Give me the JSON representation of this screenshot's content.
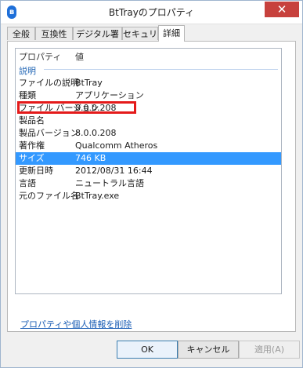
{
  "window": {
    "title": "BtTrayのプロパティ",
    "close_glyph": "✕",
    "app_icon_glyph": "ʙ"
  },
  "tabs": [
    {
      "label": "全般",
      "active": false
    },
    {
      "label": "互換性",
      "active": false
    },
    {
      "label": "デジタル署名",
      "active": false
    },
    {
      "label": "セキュリティ",
      "active": false
    },
    {
      "label": "詳細",
      "active": true
    }
  ],
  "details": {
    "header": {
      "property": "プロパティ",
      "value": "値"
    },
    "group": "説明",
    "rows": [
      {
        "key": "ファイルの説明",
        "value": "BtTray"
      },
      {
        "key": "種類",
        "value": "アプリケーション"
      },
      {
        "key": "ファイル バージョン",
        "value": "8.0.0.208",
        "highlighted": true
      },
      {
        "key": "製品名",
        "value": ""
      },
      {
        "key": "製品バージョン",
        "value": "8.0.0.208"
      },
      {
        "key": "著作権",
        "value": "Qualcomm Atheros"
      },
      {
        "key": "サイズ",
        "value": "746 KB",
        "selected": true
      },
      {
        "key": "更新日時",
        "value": "2012/08/31 16:44"
      },
      {
        "key": "言語",
        "value": "ニュートラル言語"
      },
      {
        "key": "元のファイル名",
        "value": "BtTray.exe"
      }
    ]
  },
  "remove_link": "プロパティや個人情報を削除",
  "buttons": {
    "ok": "OK",
    "cancel": "キャンセル",
    "apply": "適用(A)"
  },
  "colors": {
    "selection": "#3399ff",
    "highlight_box": "#e41a1a",
    "close_button": "#c7413d",
    "link": "#1a5db5"
  }
}
